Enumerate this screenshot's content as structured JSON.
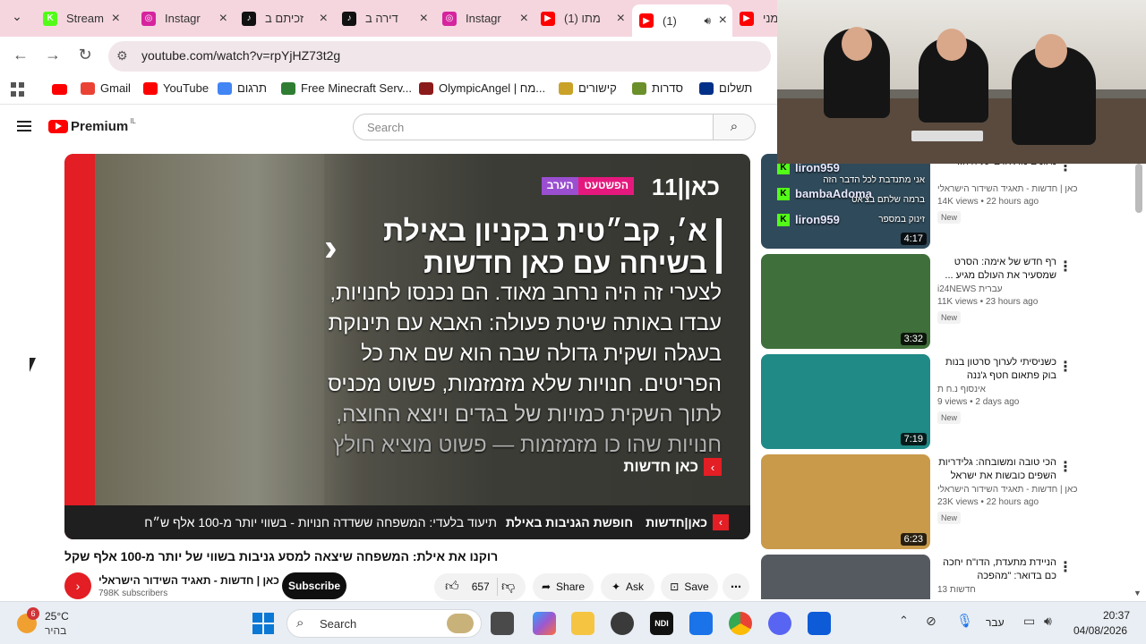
{
  "tabs": [
    {
      "title": "Stream",
      "color": "#53fc18",
      "glyph": "K"
    },
    {
      "title": "Instagr",
      "color": "#d6249f",
      "glyph": "◎"
    },
    {
      "title": "זכיתם ב",
      "color": "#111111",
      "glyph": "♪"
    },
    {
      "title": "דירה ב",
      "color": "#111111",
      "glyph": "♪"
    },
    {
      "title": "Instagr",
      "color": "#d6249f",
      "glyph": "◎"
    },
    {
      "title": "(1) מתו",
      "color": "#ff0000",
      "glyph": "▶"
    },
    {
      "title": "(1) ",
      "color": "#ff0000",
      "glyph": "▶"
    },
    {
      "title": "מני",
      "color": "#ff0000",
      "glyph": "▶"
    }
  ],
  "address": {
    "url": "youtube.com/watch?v=rpYjHZ73t2g"
  },
  "bookmarks": [
    {
      "label": "Gmail",
      "color": "#ea4335"
    },
    {
      "label": "YouTube",
      "color": "#ff0000"
    },
    {
      "label": "תרגום",
      "color": "#4285f4"
    },
    {
      "label": "Free Minecraft Serv...",
      "color": "#2e7d32"
    },
    {
      "label": "OlympicAngel | מח...",
      "color": "#8b1a1a"
    },
    {
      "label": "קישורים",
      "color": "#c9a227"
    },
    {
      "label": "סדרות",
      "color": "#6a8f2b"
    },
    {
      "label": "תשלום",
      "color": "#003087"
    }
  ],
  "youtube": {
    "logo": "Premium",
    "region": "IL",
    "search_placeholder": "Search"
  },
  "video": {
    "channel_badge": "כאן|11",
    "tag_evening": "הערב",
    "tag_show": "הפשטעט",
    "headline1": "א׳, קב״טית בקניון באילת",
    "headline2": "בשיחה עם כאן חדשות",
    "sub1": "לצערי זה היה נרחב מאוד. הם נכנסו לחנויות,",
    "sub2": "עבדו באותה שיטת פעולה: האבא עם תינוקת",
    "sub3": "בעגלה ושקית גדולה שבה הוא שם את כל",
    "sub4": "הפריטים. חנויות שלא מזמזמות, פשוט מכניס",
    "sub5": "לתוך השקית כמויות של בגדים ויוצא החוצה,",
    "sub6": "חנויות שהו כו מזמזמות — פשוט מוציא חולץ",
    "brand": "כאן חדשות",
    "ticker_brand": "כאן|חדשות",
    "ticker_title": "חופשת הגניבות באילת",
    "ticker_text": "תיעוד בלעדי: המשפחה ששדדה חנויות - בשווי יותר מ-100 אלף ש״ח"
  },
  "watch": {
    "title": "רוקנו את אילת: המשפחה שיצאה למסע גניבות בשווי של יותר מ-100 אלף שקל",
    "channel": "כאן | חדשות - תאגיד השידור הישראלי",
    "subscribers": "798K subscribers",
    "subscribe": "Subscribe",
    "likes": "657",
    "share": "Share",
    "ask": "Ask",
    "save": "Save"
  },
  "recommendations": [
    {
      "title": "נתונים מדאיגים על היהודי",
      "channel": "כאן | חדשות - תאגיד השידור הישראלי",
      "meta": "14K views • 22 hours ago",
      "badge": "New",
      "duration": "4:17",
      "thumb": "#2f4a5a"
    },
    {
      "title": "רף חדש של אימה: הסרט שמסעיר את העולם מגיע ...",
      "channel": "i24NEWS עברית",
      "meta": "11K views • 23 hours ago",
      "badge": "New",
      "duration": "3:32",
      "thumb": "#3f6f3a"
    },
    {
      "title": "כשניסיתי לערוך סרטון בנות בוק פתאום חטף ג'ננה והתחיל AI-...",
      "channel": "אינסוף נ.ח ת",
      "meta": "9 views • 2 days ago",
      "badge": "New",
      "duration": "7:19",
      "thumb": "#1f8a86"
    },
    {
      "title": "הכי טובה ומשובחה: גלידריות השפים כובשות את ישראל",
      "channel": "כאן | חדשות - תאגיד השידור הישראלי",
      "meta": "23K views • 22 hours ago",
      "badge": "New",
      "duration": "6:23",
      "thumb": "#c89a4a"
    },
    {
      "title": "הניידת מתעדת, הדו\"ח יחכה כם בדואר: \"מהפכה המצלמות\"",
      "channel": "חדשות 13",
      "meta": "",
      "badge": "",
      "duration": "",
      "thumb": "#555a60"
    }
  ],
  "overlay": {
    "chat": [
      "liron959",
      "bambaAdoma",
      "liron959"
    ],
    "chat_msgs": [
      "אני מתנדבת לכל הדבר הזה",
      "ברמה שלתם בצ'אט",
      "זינוק במספר"
    ]
  },
  "taskbar": {
    "weather_temp": "25°C",
    "weather_desc": "בהיר",
    "weather_badge": "6",
    "search": "Search",
    "lang": "עבר",
    "time": "20:37",
    "date": "04/08/2026"
  }
}
